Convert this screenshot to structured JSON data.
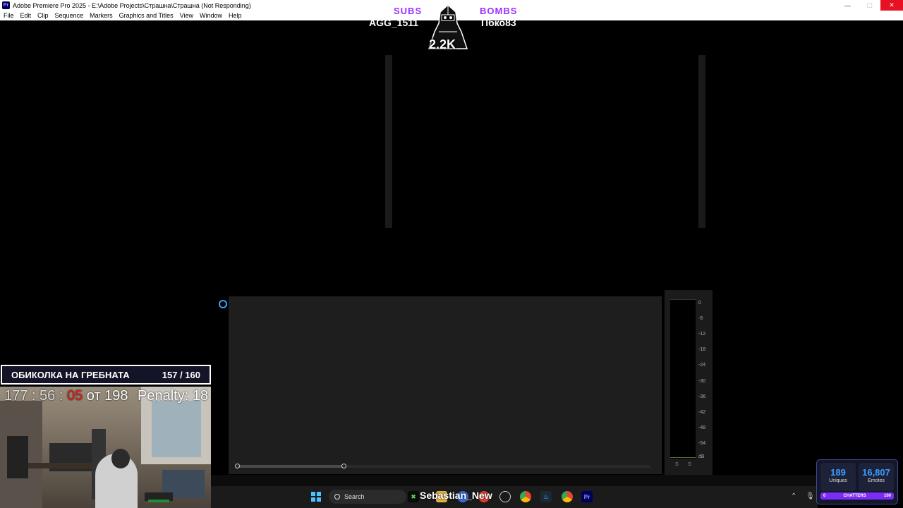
{
  "window": {
    "title": "Adobe Premiere Pro 2025 - E:\\Adobe Projects\\Страшна\\Страшна (Not Responding)",
    "app_icon": "Pr",
    "controls": {
      "minimize": "—",
      "maximize": "▢",
      "close": "✕"
    }
  },
  "menu": {
    "items": [
      "File",
      "Edit",
      "Clip",
      "Sequence",
      "Markers",
      "Graphics and Titles",
      "View",
      "Window",
      "Help"
    ]
  },
  "overlay": {
    "subs_label": "SUBS",
    "subs_name": "AGG_1511",
    "bombs_label": "BOMBS",
    "bombs_name": "Пбко83",
    "center_count": "2.2K"
  },
  "challenge": {
    "title": "ОБИКОЛКА НА ГРЕБНАТА",
    "progress": "157 / 160",
    "timer_hm": "177 : 56 : ",
    "timer_sec": "05",
    "timer_from": " от 198",
    "penalty": "Penalty: 18"
  },
  "meter": {
    "db_ticks": [
      "0",
      "-6",
      "-12",
      "-18",
      "-24",
      "-30",
      "-36",
      "-42",
      "-48",
      "-54",
      "dB"
    ],
    "solo": [
      "S",
      "S"
    ]
  },
  "taskbar": {
    "search_label": "Search",
    "user_name": "Sebastian_New",
    "icons": [
      "windows-start-icon",
      "search-icon",
      "xbox-icon",
      "file-explorer-icon",
      "chrome-icon",
      "steam-icon",
      "premiere-icon"
    ]
  },
  "stats": {
    "uniques_value": "189",
    "uniques_label": "Uniques",
    "emotes_value": "16,807",
    "emotes_label": "Emotes",
    "chatters_min": "0",
    "chatters_label": "CHATTERS",
    "chatters_max": "100"
  }
}
